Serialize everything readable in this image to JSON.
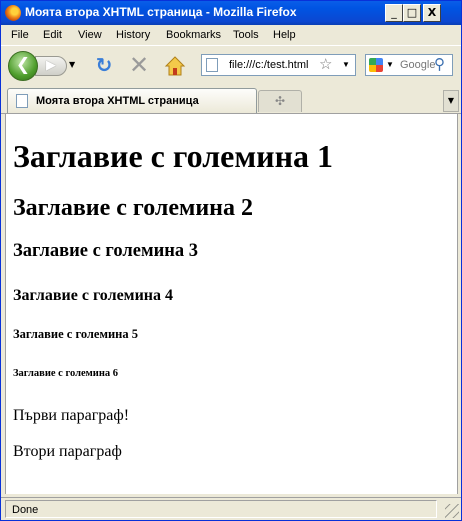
{
  "window": {
    "title": "Моята втора XHTML страница - Mozilla Firefox",
    "controls": {
      "minimize": "_",
      "maximize": "□",
      "close": "X"
    }
  },
  "menu": [
    "File",
    "Edit",
    "View",
    "History",
    "Bookmarks",
    "Tools",
    "Help"
  ],
  "toolbar": {
    "url": "file:///c:/test.html",
    "search_placeholder": "Google",
    "icons": [
      "back-icon",
      "forward-icon",
      "reload-icon",
      "stop-icon",
      "home-icon",
      "bookmark-star-icon",
      "google-icon",
      "search-icon"
    ]
  },
  "tabs": {
    "active_label": "Моята втора XHTML страница"
  },
  "page": {
    "h1": "Заглавие с големина 1",
    "h2": "Заглавие с големина 2",
    "h3": "Заглавие с големина 3",
    "h4": "Заглавие с големина 4",
    "h5": "Заглавие с големина 5",
    "h6": "Заглавие с големина 6",
    "p1": "Първи параграф!",
    "p2": "Втори параграф"
  },
  "status": {
    "text": "Done"
  },
  "colors": {
    "titlebar": "#0054e3",
    "chrome": "#ece9d8",
    "content_bg": "#ffffff"
  }
}
